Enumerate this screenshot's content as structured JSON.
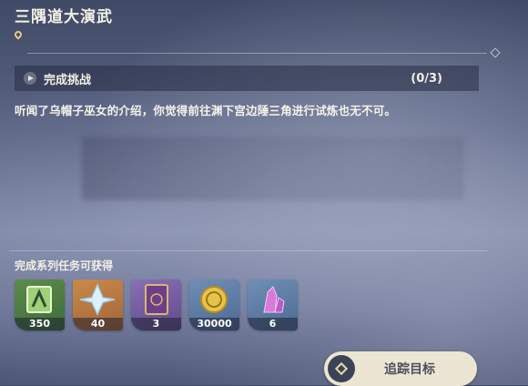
{
  "quest": {
    "title": "三隅道大演武",
    "challenge_label": "完成挑战",
    "challenge_count": "(0/3)",
    "description": "听闻了乌帽子巫女的介绍，你觉得前往渊下宫边陲三角进行试炼也无不可。"
  },
  "rewards": {
    "title": "完成系列任务可获得",
    "items": [
      {
        "icon": "adventure-exp-icon",
        "qty": "350"
      },
      {
        "icon": "primogem-icon",
        "qty": "40"
      },
      {
        "icon": "heros-wit-book-icon",
        "qty": "3"
      },
      {
        "icon": "mora-coin-icon",
        "qty": "30000"
      },
      {
        "icon": "crystal-ore-icon",
        "qty": "6"
      }
    ]
  },
  "actions": {
    "track_label": "追踪目标"
  },
  "colors": {
    "button_bg": "#ece5d3",
    "accent_gold": "#e6c88a"
  }
}
